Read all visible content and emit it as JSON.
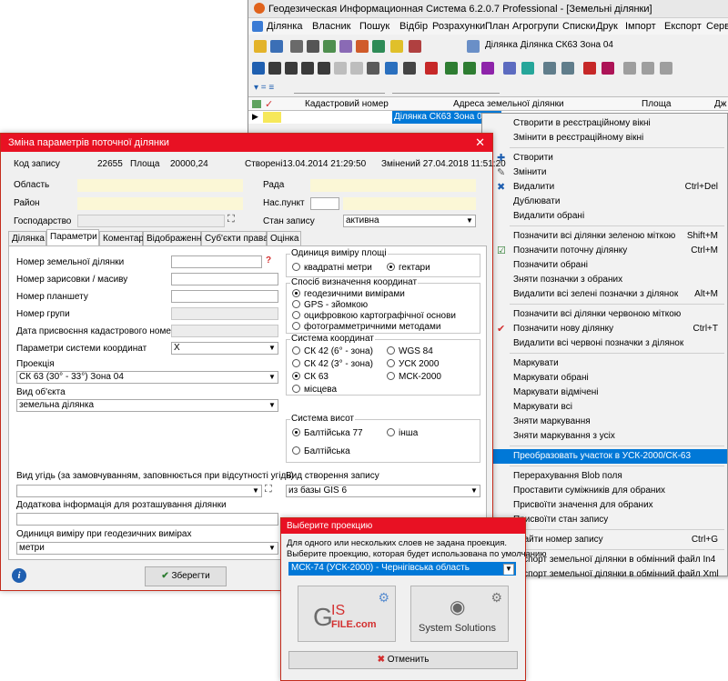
{
  "main": {
    "title": "Геодезическая Информационная Система 6.2.0.7 Professional - [Земельні ділянки]",
    "menu": [
      "Ділянка",
      "Власник",
      "Пошук",
      "Відбір",
      "Розрахунки",
      "План",
      "Агрогрупи",
      "Списки",
      "Друк",
      "Імпорт",
      "Експорт",
      "Серві"
    ],
    "layer_info": "Ділянка  Ділянка СК63 Зона 04",
    "grid": {
      "headers": [
        "Кадастровий номер",
        "Адреса земельної ділянки",
        "Площа",
        "Дж"
      ],
      "row_selected": "Ділянка СК63 Зона 04"
    }
  },
  "context_menu": {
    "items": [
      {
        "label": "Створити в реєстраційному вікні",
        "shortcut": ""
      },
      {
        "label": "Змінити в реєстраційному вікні",
        "shortcut": ""
      },
      {
        "sep": true
      },
      {
        "label": "Створити",
        "shortcut": "",
        "icon": "create-icon"
      },
      {
        "label": "Змінити",
        "shortcut": "",
        "icon": "edit-icon"
      },
      {
        "label": "Видалити",
        "shortcut": "Ctrl+Del",
        "icon": "delete-icon"
      },
      {
        "label": "Дублювати",
        "shortcut": ""
      },
      {
        "label": "Видалити обрані",
        "shortcut": ""
      },
      {
        "sep": true
      },
      {
        "label": "Позначити всі ділянки зеленою міткою",
        "shortcut": "Shift+M"
      },
      {
        "label": "Позначити поточну ділянку",
        "shortcut": "Ctrl+M",
        "icon": "green-check-icon"
      },
      {
        "label": "Позначити обрані",
        "shortcut": ""
      },
      {
        "label": "Зняти позначки з обраних",
        "shortcut": ""
      },
      {
        "label": "Видалити всі зелені позначки з ділянок",
        "shortcut": "Alt+M"
      },
      {
        "sep": true
      },
      {
        "label": "Позначити всі ділянки червоною міткою",
        "shortcut": ""
      },
      {
        "label": "Позначити нову ділянку",
        "shortcut": "Ctrl+T",
        "icon": "red-check-icon"
      },
      {
        "label": "Видалити всі червоні позначки з ділянок",
        "shortcut": ""
      },
      {
        "sep": true
      },
      {
        "label": "Маркувати",
        "shortcut": ""
      },
      {
        "label": "Маркувати обрані",
        "shortcut": ""
      },
      {
        "label": "Маркувати відмічені",
        "shortcut": ""
      },
      {
        "label": "Маркувати всі",
        "shortcut": ""
      },
      {
        "label": "Зняти маркування",
        "shortcut": ""
      },
      {
        "label": "Зняти маркування з усіх",
        "shortcut": ""
      },
      {
        "sep": true
      },
      {
        "label": "Преобразовать участок в УСК-2000/СК-63",
        "shortcut": "",
        "highlight": true
      },
      {
        "sep": true
      },
      {
        "label": "Перерахування Blob поля",
        "shortcut": ""
      },
      {
        "label": "Проставити суміжників для обраних",
        "shortcut": ""
      },
      {
        "label": "Присвоїти значення для обраних",
        "shortcut": ""
      },
      {
        "label": "Присвоїти стан запису",
        "shortcut": ""
      },
      {
        "sep": true
      },
      {
        "label": "Знайти номер запису",
        "shortcut": "Ctrl+G"
      },
      {
        "sep": true
      },
      {
        "label": "Експорт земельної ділянки в обмінний файл In4",
        "shortcut": ""
      },
      {
        "label": "Експорт земельної ділянки в обмінний файл Xml",
        "shortcut": ""
      }
    ]
  },
  "dialog": {
    "title": "Зміна параметрів поточної ділянки",
    "close": "✕",
    "header": {
      "code_label": "Код запису",
      "code_value": "22655",
      "area_label": "Площа",
      "area_value": "20000,24",
      "created": "Створені13.04.2014 21:29:50",
      "changed": "Змінений  27.04.2018 11:51:20"
    },
    "fields": {
      "oblast": "Область",
      "rayon": "Район",
      "gospodarstvo": "Господарство",
      "rada": "Рада",
      "naspunkt": "Нас.пункт",
      "stan_label": "Стан запису",
      "stan_value": "активна"
    },
    "tabs": [
      "Ділянка",
      "Параметри",
      "Коментарі",
      "Відображення",
      "Суб'єкти права",
      "Оцінка"
    ],
    "params": {
      "nomer_dilyanky": "Номер земельної ділянки",
      "nomer_zarysovky": "Номер зарисовки / масиву",
      "nomer_planshetu": "Номер планшету",
      "nomer_grupy": "Номер групи",
      "data_prysvoennya": "Дата присвоєння кадастрового номера",
      "parametry_systemy": "Параметри системи координат",
      "parametry_value": "X",
      "proektsiya_label": "Проекція",
      "proektsiya_value": "СК 63 (30° - 33°) Зона 04",
      "vyd_obekta_label": "Вид об'єкта",
      "vyd_obekta_value": "земельна ділянка",
      "vyd_ugid_label": "Вид угідь (за замовчуванням, заповнюється при відсутності угідь)",
      "dodatkova_label": "Додаткова інформація для розташування ділянки",
      "odynytsya_geo_label": "Одиниця виміру при геодезичних вимірах",
      "odynytsya_geo_value": "метри",
      "vyd_stvorennya_label": "Вид створення запису",
      "vyd_stvorennya_value": "из базы GIS 6"
    },
    "groups": {
      "area_unit": {
        "title": "Одиниця виміру площі",
        "options": [
          "квадратні метри",
          "гектари"
        ],
        "selected": 1
      },
      "coord_method": {
        "title": "Спосіб визначення координат",
        "options": [
          "геодезичними вимірами",
          "GPS - зйомкою",
          "оцифровкою картографічної основи",
          "фотограмметричними методами"
        ],
        "selected": 0
      },
      "coord_system": {
        "title": "Система координат",
        "options": [
          "СК 42 (6° - зона)",
          "WGS 84",
          "СК 42 (3° - зона)",
          "УСК 2000",
          "СК 63",
          "МСК-2000",
          "місцева"
        ],
        "selected": 4
      },
      "height_system": {
        "title": "Система висот",
        "options": [
          "Балтійська 77",
          "інша",
          "Балтійська"
        ],
        "selected": 0
      }
    },
    "save_button": "Зберегти"
  },
  "projection": {
    "title": "Выберите проекцию",
    "line1": "Для одного или нескольких слоев не задана проекция.",
    "line2": "Выберите проекцию, которая будет использована по умолчанию",
    "select_value": "МСК-74 (УСК-2000) - Чернігівська область",
    "logo1_top": "IS",
    "logo1_bottom": "FILE.com",
    "logo1_g": "G",
    "logo2": "System Solutions",
    "cancel": "Отменить"
  },
  "colors": {
    "title_red": "#e81123",
    "highlight": "#0078d7",
    "field_yellow": "#fbf7d6"
  }
}
